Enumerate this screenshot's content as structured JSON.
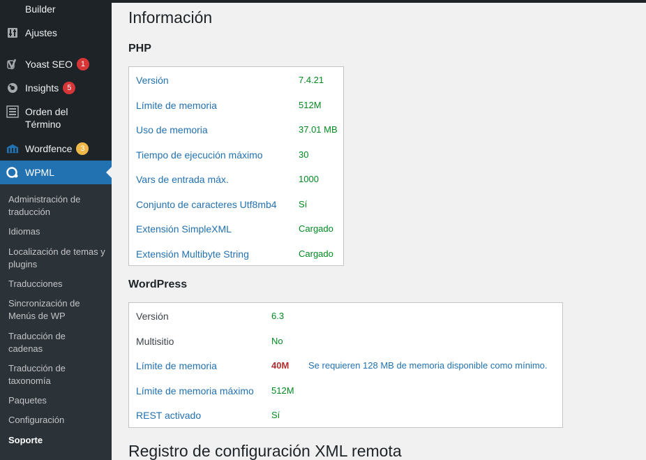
{
  "sidebar": {
    "items": [
      {
        "label": "Builder",
        "icon": "builder-icon"
      },
      {
        "label": "Ajustes",
        "icon": "settings-sliders-icon"
      },
      {
        "label": "Yoast SEO",
        "icon": "yoast-icon",
        "badge": "1"
      },
      {
        "label": "Insights",
        "icon": "insights-icon",
        "badge": "5"
      },
      {
        "label": "Orden del Término",
        "icon": "list-icon"
      },
      {
        "label": "Wordfence",
        "icon": "wordfence-icon",
        "badge": "3"
      },
      {
        "label": "WPML",
        "icon": "wpml-icon"
      }
    ],
    "submenu": [
      "Administración de traducción",
      "Idiomas",
      "Localización de temas y plugins",
      "Traducciones",
      "Sincronización de Menús de WP",
      "Traducción de cadenas",
      "Traducción de taxonomía",
      "Paquetes",
      "Configuración",
      "Soporte"
    ]
  },
  "main": {
    "title": "Información",
    "php": {
      "heading": "PHP",
      "rows": [
        {
          "label": "Versión",
          "value": "7.4.21"
        },
        {
          "label": "Límite de memoria",
          "value": "512M"
        },
        {
          "label": "Uso de memoria",
          "value": "37.01 MB"
        },
        {
          "label": "Tiempo de ejecución máximo",
          "value": "30"
        },
        {
          "label": "Vars de entrada máx.",
          "value": "1000"
        },
        {
          "label": "Conjunto de caracteres Utf8mb4",
          "value": "Sí"
        },
        {
          "label": "Extensión SimpleXML",
          "value": "Cargado"
        },
        {
          "label": "Extensión Multibyte String",
          "value": "Cargado"
        }
      ]
    },
    "wordpress": {
      "heading": "WordPress",
      "rows": [
        {
          "label": "Versión",
          "value": "6.3"
        },
        {
          "label": "Multisitio",
          "value": "No"
        },
        {
          "label": "Límite de memoria",
          "value": "40M",
          "note": "Se requieren 128 MB de memoria disponible como mínimo."
        },
        {
          "label": "Límite de memoria máximo",
          "value": "512M"
        },
        {
          "label": "REST activado",
          "value": "Sí"
        }
      ]
    },
    "bottom_title": "Registro de configuración XML remota"
  },
  "colors": {
    "sidebar_bg": "#1d2327",
    "submenu_bg": "#2c3338",
    "active_bg": "#2271b1",
    "value_green": "#008a20",
    "error_red": "#b32d2e",
    "link_blue": "#2271b1"
  }
}
